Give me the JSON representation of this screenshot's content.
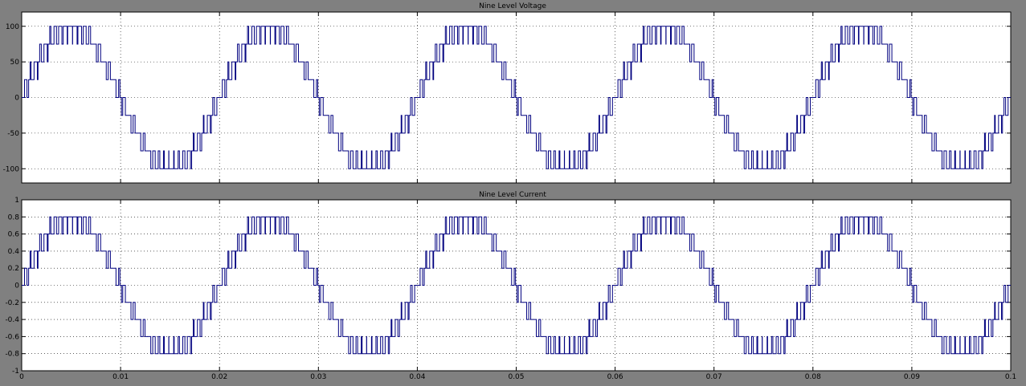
{
  "figure": {
    "background": "#808080",
    "plot_background": "#ffffff",
    "line_color": "#00007f"
  },
  "chart_data": [
    {
      "type": "line",
      "title": "Nine Level Voltage",
      "xlabel": "",
      "ylabel": "",
      "xlim": [
        0,
        0.1
      ],
      "ylim": [
        -120,
        120
      ],
      "yticks": [
        -100,
        -50,
        0,
        50,
        100
      ],
      "ytick_labels": [
        "-100",
        "-50",
        "0",
        "50",
        "100"
      ],
      "xticks": [
        0,
        0.01,
        0.02,
        0.03,
        0.04,
        0.05,
        0.06,
        0.07,
        0.08,
        0.09,
        0.1
      ],
      "grid": true,
      "waveform": {
        "kind": "nine-level staircase with PWM switching",
        "frequency_hz": 50,
        "step_size": 25,
        "levels": [
          -100,
          -75,
          -50,
          -25,
          0,
          25,
          50,
          75,
          100
        ],
        "peak": 100
      },
      "series": [
        {
          "values": []
        }
      ]
    },
    {
      "type": "line",
      "title": "Nine Level Current",
      "xlabel": "",
      "ylabel": "",
      "xlim": [
        0,
        0.1
      ],
      "ylim": [
        -1,
        1
      ],
      "yticks": [
        -1,
        -0.8,
        -0.6,
        -0.4,
        -0.2,
        0,
        0.2,
        0.4,
        0.6,
        0.8,
        1
      ],
      "ytick_labels": [
        "-1",
        "-0.8",
        "-0.6",
        "-0.4",
        "-0.2",
        "0",
        "0.2",
        "0.4",
        "0.6",
        "0.8",
        "1"
      ],
      "xticks": [
        0,
        0.01,
        0.02,
        0.03,
        0.04,
        0.05,
        0.06,
        0.07,
        0.08,
        0.09,
        0.1
      ],
      "xtick_labels": [
        "0",
        "0.01",
        "0.02",
        "0.03",
        "0.04",
        "0.05",
        "0.06",
        "0.07",
        "0.08",
        "0.09",
        "0.1"
      ],
      "grid": true,
      "waveform": {
        "kind": "nine-level staircase with PWM switching",
        "frequency_hz": 50,
        "step_size": 0.2,
        "levels": [
          -0.8,
          -0.6,
          -0.4,
          -0.2,
          0,
          0.2,
          0.4,
          0.6,
          0.8
        ],
        "peak": 0.8
      },
      "series": [
        {
          "values": []
        }
      ]
    }
  ]
}
